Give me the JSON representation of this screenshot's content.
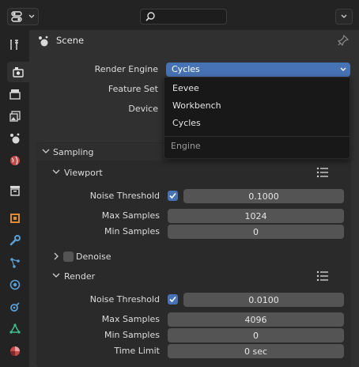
{
  "header": {
    "editor_type_icon": "properties-editor-icon",
    "search_icon": "search-icon",
    "search_placeholder": "",
    "filter_icon": "chevron-down-icon"
  },
  "tabs": [
    {
      "name": "tool",
      "icon": "tool-icon",
      "active": false
    },
    {
      "name": "render",
      "icon": "render-icon",
      "active": true
    },
    {
      "name": "output",
      "icon": "output-icon",
      "active": false
    },
    {
      "name": "view-layer",
      "icon": "view-layer-icon",
      "active": false
    },
    {
      "name": "scene",
      "icon": "scene-icon",
      "active": false
    },
    {
      "name": "world",
      "icon": "world-icon",
      "active": false
    },
    {
      "name": "collection",
      "icon": "collection-icon",
      "active": false
    },
    {
      "name": "object",
      "icon": "object-icon",
      "active": false
    },
    {
      "name": "modifiers",
      "icon": "wrench-icon",
      "active": false
    },
    {
      "name": "particles",
      "icon": "particles-icon",
      "active": false
    },
    {
      "name": "physics",
      "icon": "physics-icon",
      "active": false
    },
    {
      "name": "constraints",
      "icon": "constraint-icon",
      "active": false
    },
    {
      "name": "data",
      "icon": "mesh-data-icon",
      "active": false
    },
    {
      "name": "material",
      "icon": "material-icon",
      "active": false
    }
  ],
  "context": {
    "scene_label": "Scene",
    "scene_icon": "scene-icon",
    "pin_icon": "pin-icon"
  },
  "render_settings": {
    "render_engine_label": "Render Engine",
    "render_engine_value": "Cycles",
    "feature_set_label": "Feature Set",
    "device_label": "Device"
  },
  "engine_menu": {
    "items": [
      "Eevee",
      "Workbench",
      "Cycles"
    ],
    "title": "Engine"
  },
  "sampling": {
    "title": "Sampling",
    "viewport": {
      "title": "Viewport",
      "noise_threshold_label": "Noise Threshold",
      "noise_threshold_enabled": true,
      "noise_threshold_value": "0.1000",
      "max_samples_label": "Max Samples",
      "max_samples_value": "1024",
      "min_samples_label": "Min Samples",
      "min_samples_value": "0",
      "denoise_label": "Denoise",
      "denoise_enabled": false
    },
    "render": {
      "title": "Render",
      "noise_threshold_label": "Noise Threshold",
      "noise_threshold_enabled": true,
      "noise_threshold_value": "0.0100",
      "max_samples_label": "Max Samples",
      "max_samples_value": "4096",
      "min_samples_label": "Min Samples",
      "min_samples_value": "0",
      "time_limit_label": "Time Limit",
      "time_limit_value": "0 sec"
    }
  }
}
